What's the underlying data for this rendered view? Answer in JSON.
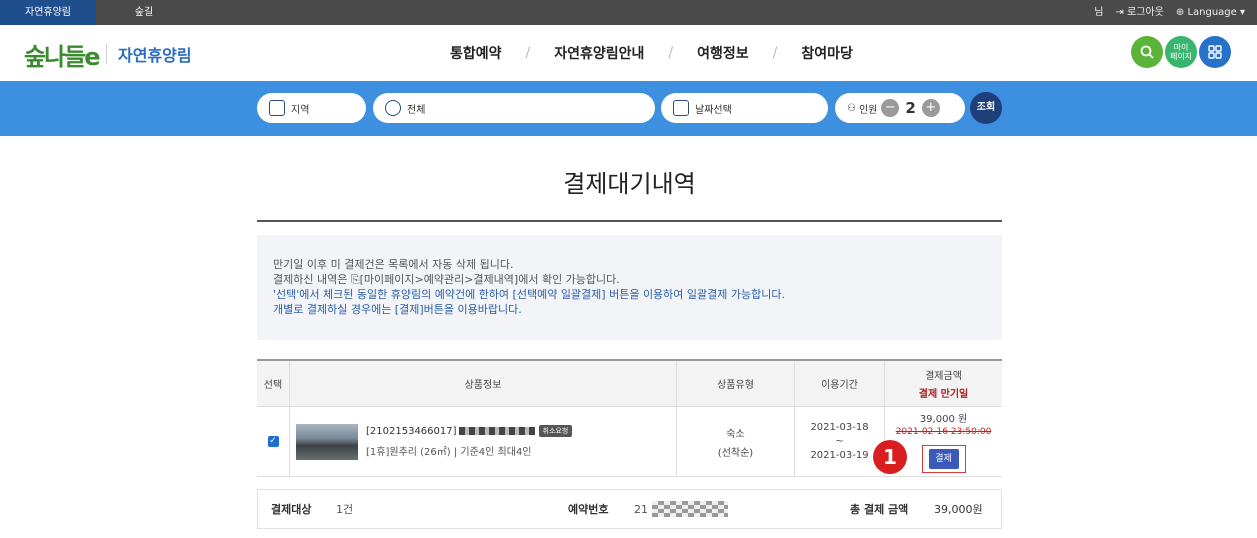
{
  "topbar": {
    "tabs": [
      "자연휴양림",
      "숲길"
    ],
    "user": "님",
    "logout": "로그아웃",
    "language": "Language ▾"
  },
  "header": {
    "logo_mark": "숲나들e",
    "logo_text": "자연휴양림",
    "nav": [
      "통합예약",
      "자연휴양림안내",
      "여행정보",
      "참여마당"
    ],
    "nav_sep": "/",
    "mypage_label": "마이\n페이지"
  },
  "search": {
    "region": "지역",
    "forest": "전체",
    "date": "날짜선택",
    "people_label": "인원",
    "people_count": "2",
    "minus": "−",
    "plus": "+",
    "submit": "조회"
  },
  "page": {
    "title": "결제대기내역"
  },
  "notice": {
    "line1": "만기일 이후 미 결제건은 목록에서 자동 삭제 됩니다.",
    "line2": "결제하신 내역은 ⎘[마이페이지>예약관리>결제내역]에서 확인 가능합니다.",
    "line3": "'선택'에서 체크된 동일한 휴양림의 예약건에 한하여 [선택예약 일괄결제] 버튼을 이용하여 일괄결제 가능합니다.",
    "line4": "개별로 결제하실 경우에는 [결제]버튼을 이용바랍니다."
  },
  "table": {
    "headers": {
      "select": "선택",
      "product": "상품정보",
      "type": "상품유형",
      "period": "이용기간",
      "amount": "결제금액",
      "due": "결제 만기일"
    },
    "row": {
      "code": "[2102153466017]",
      "badge": "취소요청",
      "desc": "[1휴]원추리 (26㎡) | 기준4인 최대4인",
      "type_main": "숙소",
      "type_sub": "(선착순)",
      "period_start": "2021-03-18",
      "period_sep": "~",
      "period_end": "2021-03-19",
      "price": "39,000 원",
      "due_date": "2021-02-16 23:50:00",
      "pay_button": "결제"
    }
  },
  "marker": "1",
  "summary": {
    "target_label": "결제대상",
    "target_value": "1건",
    "reservation_label": "예약번호",
    "reservation_prefix": "21",
    "total_label": "총 결제 금액",
    "total_value": "39,000원"
  }
}
